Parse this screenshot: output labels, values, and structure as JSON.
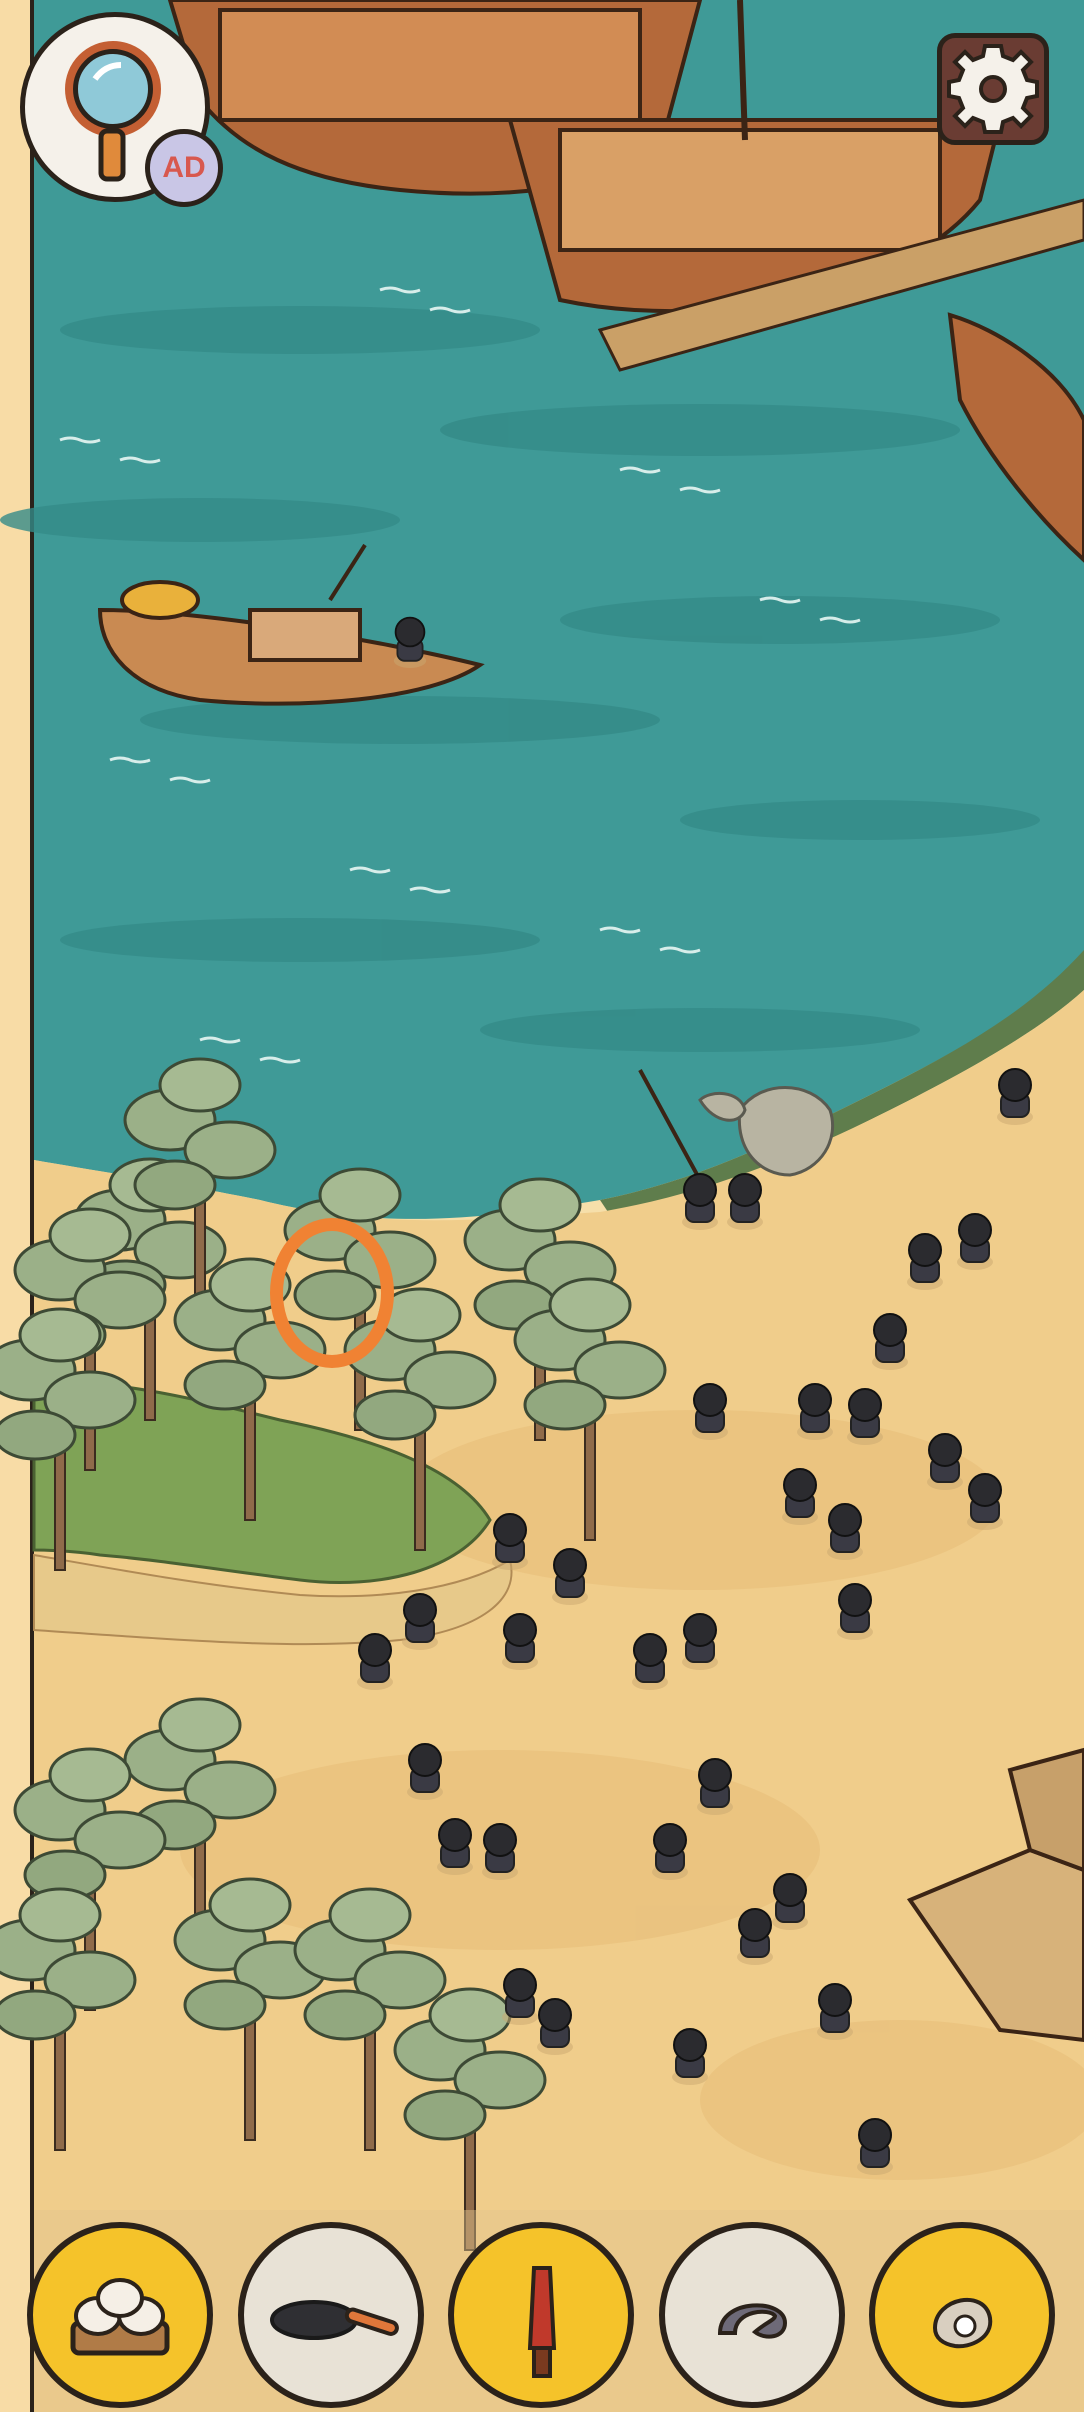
{
  "hud": {
    "hint_badge": "AD",
    "hint_icon": "magnifier-icon",
    "settings_icon": "gear-icon"
  },
  "found_marker": {
    "color": "#f08233"
  },
  "targets": [
    {
      "name": "steamed-buns",
      "state": "found"
    },
    {
      "name": "frying-pan",
      "state": "pending"
    },
    {
      "name": "knife",
      "state": "found"
    },
    {
      "name": "horseshoe",
      "state": "pending"
    },
    {
      "name": "oyster-pearl",
      "state": "found"
    }
  ],
  "colors": {
    "water": "#3f9a97",
    "sand": "#f0cd8b",
    "found_slot": "#f5c32a",
    "pending_slot": "#e8e2d6"
  }
}
